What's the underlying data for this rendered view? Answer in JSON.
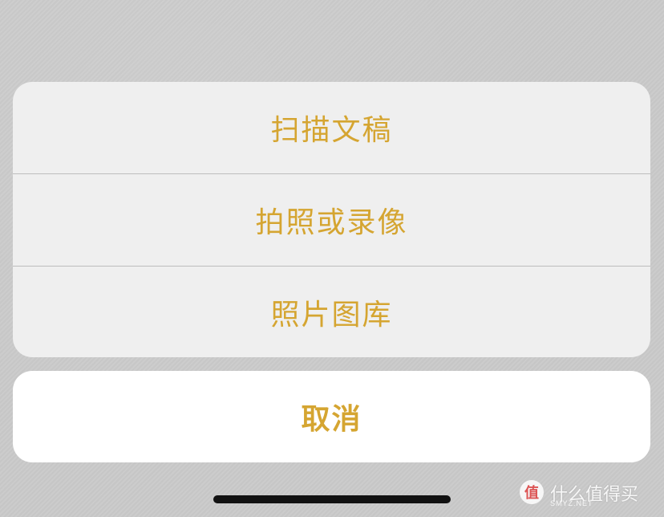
{
  "action_sheet": {
    "items": [
      {
        "label": "扫描文稿"
      },
      {
        "label": "拍照或录像"
      },
      {
        "label": "照片图库"
      }
    ],
    "cancel_label": "取消"
  },
  "watermark": {
    "icon_glyph": "值",
    "text": "什么值得买",
    "subtext": "SMYZ.NET"
  },
  "colors": {
    "accent": "#d5a531",
    "sheet_background": "#efefef",
    "cancel_background": "#ffffff",
    "backdrop": "#cacaca"
  }
}
